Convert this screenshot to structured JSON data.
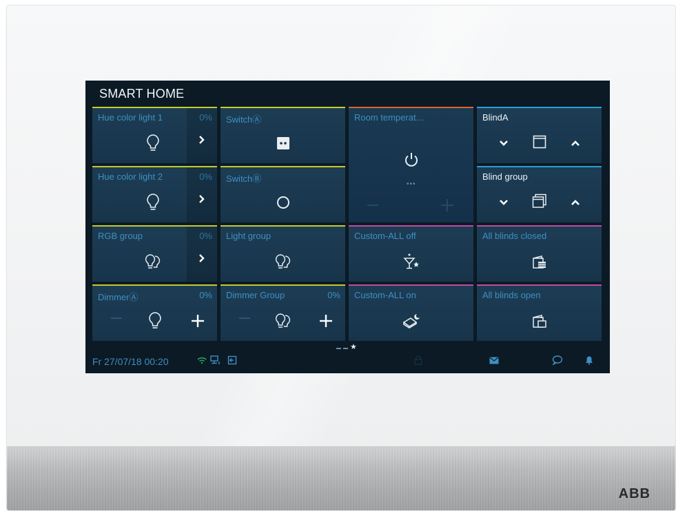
{
  "title": "SMART HOME",
  "brand": "ABB",
  "tiles": {
    "hue1": {
      "label": "Hue color light 1",
      "value": "0%",
      "icon": "bulb-icon"
    },
    "switch_a": {
      "label": "SwitchⒶ",
      "icon": "socket-icon"
    },
    "room_temp": {
      "label": "Room temperat…",
      "icon": "power-icon",
      "dots": "•••"
    },
    "blind_a": {
      "label": "BlindA",
      "icon": "window-icon"
    },
    "hue2": {
      "label": "Hue color light 2",
      "value": "0%",
      "icon": "bulb-icon"
    },
    "switch_b": {
      "label": "SwitchⒷ",
      "icon": "circle-icon"
    },
    "blind_group": {
      "label": "Blind group",
      "icon": "stacked-windows-icon"
    },
    "rgb_group": {
      "label": "RGB group",
      "value": "0%",
      "icon": "double-bulb-icon"
    },
    "light_group": {
      "label": "Light group",
      "icon": "double-bulb-icon"
    },
    "custom_all_off": {
      "label": "Custom-ALL off",
      "icon": "cocktail-star-icon"
    },
    "all_blinds_closed": {
      "label": "All blinds closed",
      "icon": "blinds-closed-icon"
    },
    "dimmer_a": {
      "label": "DimmerⒶ",
      "value": "0%",
      "icon": "bulb-icon"
    },
    "dimmer_group": {
      "label": "Dimmer Group",
      "value": "0%",
      "icon": "double-bulb-icon"
    },
    "custom_all_on": {
      "label": "Custom-ALL on",
      "icon": "bed-moon-icon"
    },
    "all_blinds_open": {
      "label": "All blinds open",
      "icon": "blinds-open-icon"
    }
  },
  "status": {
    "datetime": "Fr 27/07/18  00:20",
    "icons": [
      "wifi-icon",
      "network-icon",
      "exit-icon",
      "lock-icon",
      "mail-icon",
      "chat-icon",
      "bell-icon"
    ],
    "page_indicator": "★"
  },
  "colors": {
    "tile_bg": "#1d3d55",
    "label_blue": "#3e8fc2",
    "accent_yellow": "#c6cc2a",
    "accent_orange": "#d9652b",
    "accent_blue": "#2a9fd6",
    "accent_pink": "#c14b9c"
  }
}
